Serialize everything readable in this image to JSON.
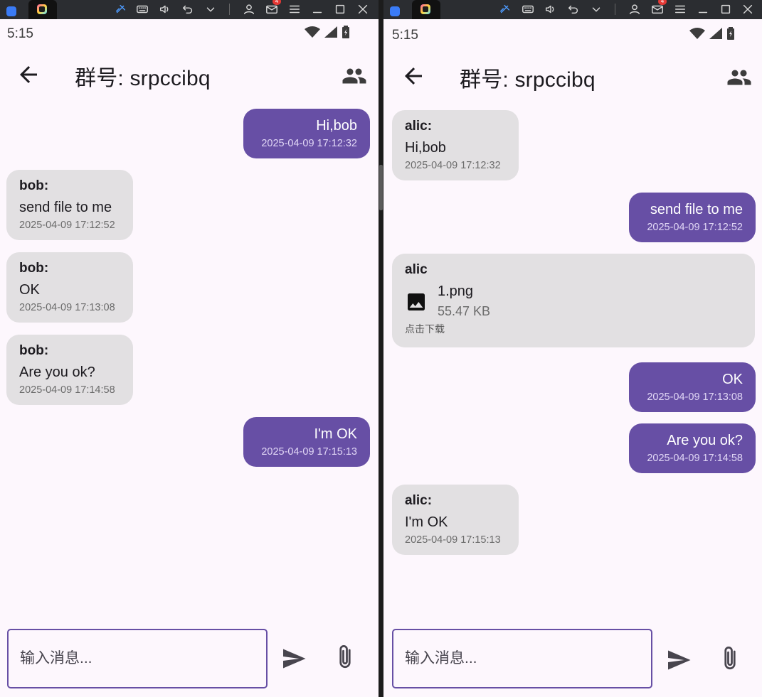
{
  "emulator": {
    "notification_count": "4"
  },
  "left": {
    "status_time": "5:15",
    "title": "群号: srpccibq",
    "input_placeholder": "输入消息...",
    "messages": [
      {
        "direction": "out",
        "text": "Hi,bob",
        "time": "2025-04-09 17:12:32"
      },
      {
        "direction": "in",
        "sender": "bob:",
        "text": "send file to me",
        "time": "2025-04-09 17:12:52"
      },
      {
        "direction": "in",
        "sender": "bob:",
        "text": "OK",
        "time": "2025-04-09 17:13:08"
      },
      {
        "direction": "in",
        "sender": "bob:",
        "text": "Are you ok?",
        "time": "2025-04-09 17:14:58"
      },
      {
        "direction": "out",
        "text": "I'm OK",
        "time": "2025-04-09 17:15:13"
      }
    ]
  },
  "right": {
    "status_time": "5:15",
    "title": "群号: srpccibq",
    "input_placeholder": "输入消息...",
    "messages": [
      {
        "direction": "in",
        "sender": "alic:",
        "text": "Hi,bob",
        "time": "2025-04-09 17:12:32"
      },
      {
        "direction": "out",
        "text": "send file to me",
        "time": "2025-04-09 17:12:52"
      },
      {
        "direction": "file",
        "sender": "alic",
        "file_name": "1.png",
        "file_size": "55.47 KB",
        "hint": "点击下载",
        "icon": "image-icon"
      },
      {
        "direction": "out",
        "text": "OK",
        "time": "2025-04-09 17:13:08"
      },
      {
        "direction": "out",
        "text": "Are you ok?",
        "time": "2025-04-09 17:14:58"
      },
      {
        "direction": "in",
        "sender": "alic:",
        "text": "I'm OK",
        "time": "2025-04-09 17:15:13"
      }
    ]
  },
  "colors": {
    "accent": "#674fa5",
    "incoming_bubble": "#e2e0e2",
    "background": "#fdf7fd"
  }
}
